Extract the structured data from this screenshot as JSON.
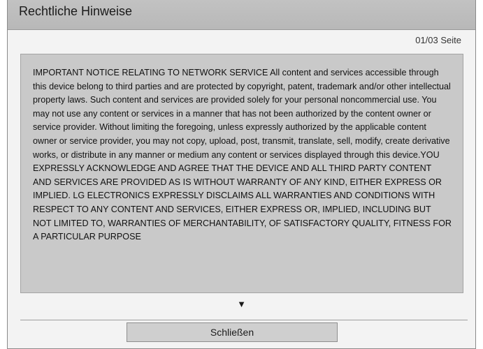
{
  "dialog": {
    "title": "Rechtliche Hinweise",
    "page_indicator": "01/03 Seite",
    "content": "IMPORTANT NOTICE RELATING TO NETWORK SERVICE All content and services accessible through this device belong to third parties and are protected by copyright, patent, trademark and/or other intellectual property laws. Such content and services are provided solely for your personal noncommercial use. You may not use any content or services in a manner that has not been authorized by the content owner or service provider. Without limiting the foregoing, unless expressly authorized by the applicable content owner or service provider, you may not copy, upload, post, transmit, translate, sell, modify, create derivative works, or distribute in any manner or medium any content or services displayed through this device.YOU EXPRESSLY ACKNOWLEDGE AND AGREE THAT THE DEVICE AND ALL THIRD PARTY CONTENT AND SERVICES ARE PROVIDED AS IS WITHOUT WARRANTY OF ANY KIND, EITHER EXPRESS OR IMPLIED. LG ELECTRONICS EXPRESSLY DISCLAIMS ALL WARRANTIES AND CONDITIONS WITH RESPECT TO ANY CONTENT AND SERVICES, EITHER EXPRESS OR, IMPLIED, INCLUDING BUT NOT LIMITED TO, WARRANTIES OF MERCHANTABILITY, OF SATISFACTORY QUALITY, FITNESS FOR A PARTICULAR PURPOSE",
    "scroll_arrow_glyph": "▼",
    "close_label": "Schließen"
  },
  "icons": {
    "scroll_down": "down-arrow-icon"
  }
}
